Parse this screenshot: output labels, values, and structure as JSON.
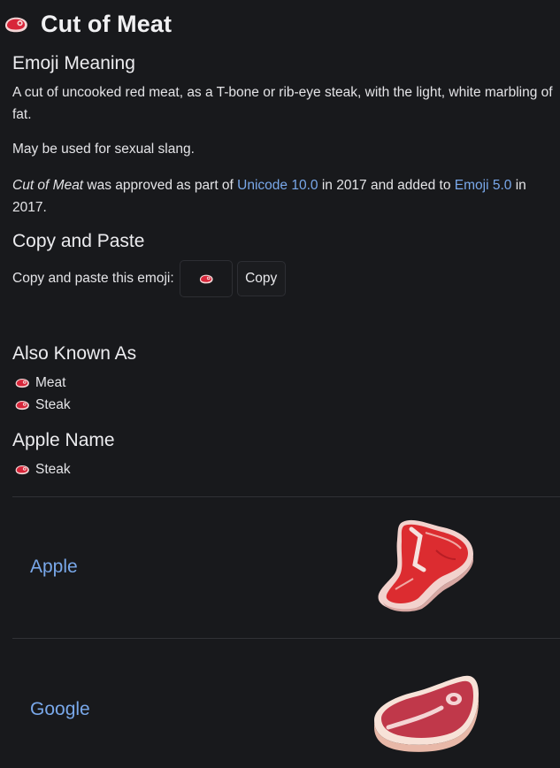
{
  "emoji": {
    "name": "Cut of Meat",
    "glyph": "🥩",
    "icon": "cut-of-meat-emoji-icon"
  },
  "meaning": {
    "heading": "Emoji Meaning",
    "desc": "A cut of uncooked red meat, as a T-bone or rib-eye steak, with the light, white marbling of fat.",
    "slang": "May be used for sexual slang.",
    "approval": {
      "name": "Cut of Meat",
      "part1": " was approved as part of ",
      "unicode_link": "Unicode 10.0",
      "part2": " in 2017 and added to ",
      "emoji_link": "Emoji 5.0",
      "part3": " in 2017."
    }
  },
  "copy": {
    "heading": "Copy and Paste",
    "label": "Copy and paste this emoji:",
    "button": "Copy"
  },
  "aka": {
    "heading": "Also Known As",
    "items": [
      "Meat",
      "Steak"
    ]
  },
  "apple_name": {
    "heading": "Apple Name",
    "items": [
      "Steak"
    ]
  },
  "vendors": [
    {
      "name": "Apple",
      "image": "apple-t-bone-steak-emoji"
    },
    {
      "name": "Google",
      "image": "google-steak-emoji"
    }
  ],
  "colors": {
    "background": "#18191c",
    "link": "#79a8ea",
    "text": "#e4e4e7",
    "meat_red": "#d8263a"
  }
}
